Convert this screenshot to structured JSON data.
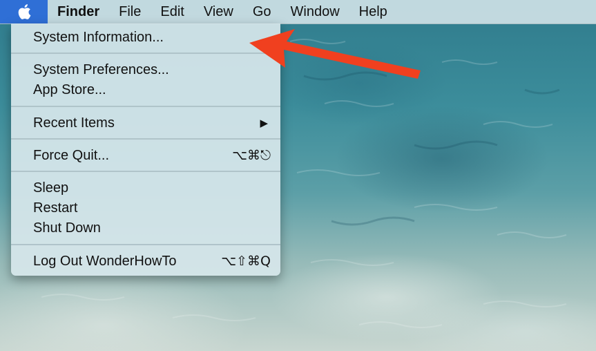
{
  "menubar": {
    "apple_icon": "apple-logo-icon",
    "items": [
      {
        "label": "Finder"
      },
      {
        "label": "File"
      },
      {
        "label": "Edit"
      },
      {
        "label": "View"
      },
      {
        "label": "Go"
      },
      {
        "label": "Window"
      },
      {
        "label": "Help"
      }
    ]
  },
  "apple_menu": {
    "items": [
      {
        "label": "System Information..."
      },
      {
        "label": "System Preferences..."
      },
      {
        "label": "App Store..."
      },
      {
        "label": "Recent Items",
        "submenu_glyph": "▶"
      },
      {
        "label": "Force Quit...",
        "shortcut": "⌥⌘⎋"
      },
      {
        "label": "Sleep"
      },
      {
        "label": "Restart"
      },
      {
        "label": "Shut Down"
      },
      {
        "label": "Log Out WonderHowTo",
        "shortcut": "⌥⇧⌘Q"
      }
    ]
  },
  "annotation": {
    "arrow_color": "#f0401f",
    "arrow_icon": "red-arrow-icon"
  },
  "colors": {
    "apple_highlight": "#2f6fd6"
  }
}
